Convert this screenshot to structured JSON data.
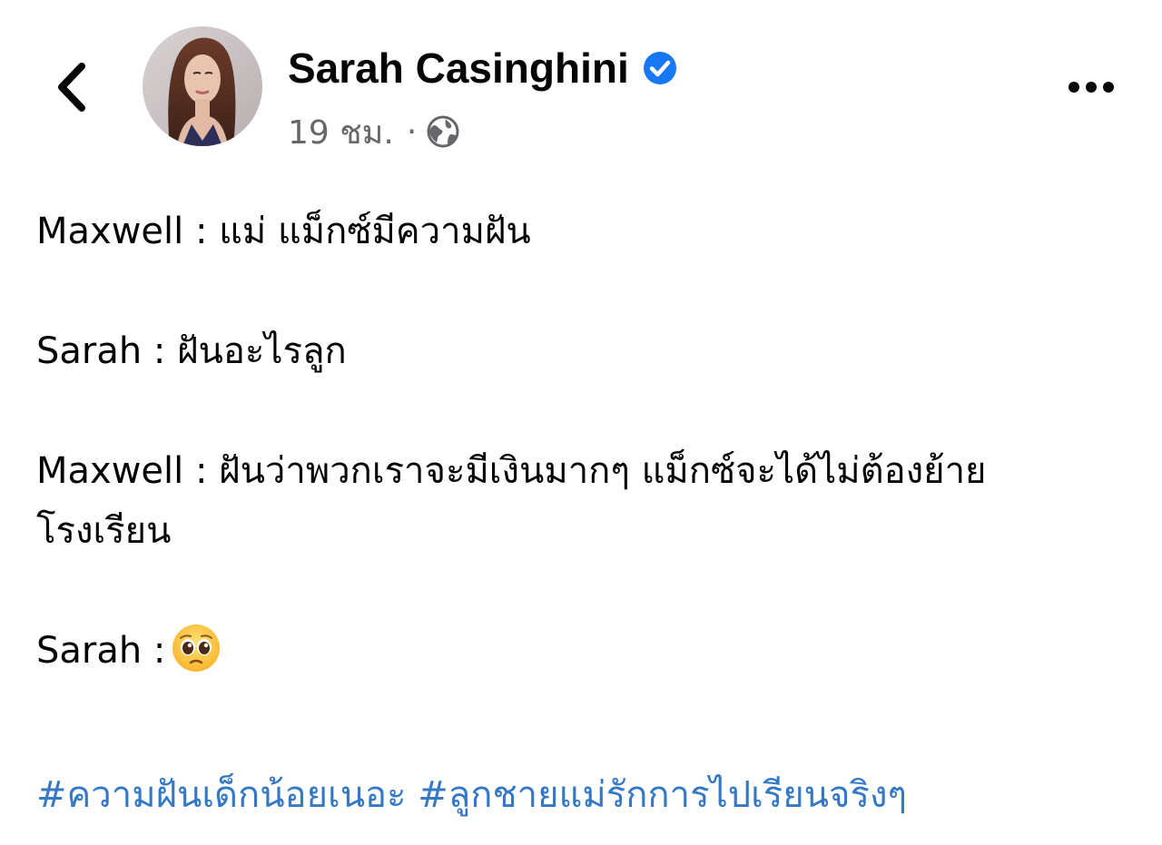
{
  "post": {
    "author": {
      "name": "Sarah Casinghini",
      "verified": true,
      "avatar": "profile-photo"
    },
    "meta": {
      "time": "19 ชม.",
      "separator": "·",
      "audience_icon": "globe-icon"
    },
    "paragraphs": [
      {
        "lines": [
          "Maxwell : แม่ แม็กซ์มีความฝัน"
        ]
      },
      {
        "lines": [
          "Sarah : ฝันอะไรลูก"
        ]
      },
      {
        "lines": [
          "Maxwell : ฝันว่าพวกเราจะมีเงินมากๆ แม็กซ์จะได้ไม่ต้องย้าย",
          "โรงเรียน"
        ]
      },
      {
        "lines": [
          "Sarah :"
        ],
        "emoji": "pleading-face-emoji"
      }
    ],
    "hashtags": [
      "#ความฝันเด็กน้อยเนอะ",
      "#ลูกชายแม่รักการไปเรียนจริงๆ"
    ]
  },
  "icons": {
    "back": "chevron-left-icon",
    "more": "more-horizontal-icon",
    "verified": "verified-badge-icon"
  },
  "colors": {
    "text": "#050505",
    "secondary_text": "#65676b",
    "verified_badge": "#1877f2",
    "hashtag": "#3578c6",
    "background": "#ffffff"
  }
}
